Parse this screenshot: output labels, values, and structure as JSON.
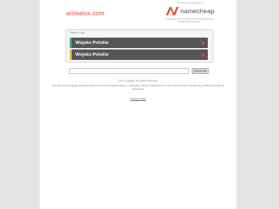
{
  "domain": "armialux.com",
  "registrar": {
    "top_text": "This domain is registered at",
    "logo_text": "namecheap",
    "bottom_text": "This domain was recently registered at Namecheap. Please check back later!",
    "brand_color": "#e8473b"
  },
  "related": {
    "title": "Related Links",
    "links": [
      {
        "label": "Wojsko Polskie",
        "accent": "#2bb57a"
      },
      {
        "label": "Wojsko Polskie",
        "accent": "#d8c030"
      }
    ]
  },
  "search": {
    "value": "",
    "button_label": "Search Ads"
  },
  "footer": {
    "copyright": "2020 Copyright. All Rights Reserved.",
    "disclaimer": "The Sponsored Listings displayed above are served automatically by a third party. Neither ParkingCrew nor the domain owner maintain any relationship with the advertisers.",
    "privacy_label": "Privacy Policy"
  }
}
